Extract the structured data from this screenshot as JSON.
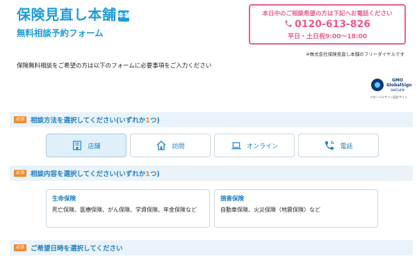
{
  "header": {
    "logo_main": "保険見直し本舗",
    "logo_mark": "本舗",
    "logo_sub": "無料相談予約フォーム"
  },
  "callbox": {
    "line1": "本日中のご相談希望の方は下記へお電話ください",
    "phone": "0120-613-826",
    "hours": "平日・土日祝9:00〜18:00",
    "color": "#e85a8f"
  },
  "note": "※株式会社保険見直し本舗のフリーダイヤルです",
  "intro": "保険無料相談をご希望の方は以下のフォームに必要事項をご入力ください",
  "gmo": {
    "line1": "GMO",
    "line2": "GlobalSign",
    "line3": "secure",
    "line4": "クローバルサイン認証サイト"
  },
  "required_label": "必須",
  "sections": [
    {
      "title_a": "相談方法を選択してください(いずれか",
      "count": "1",
      "title_b": "つ)"
    },
    {
      "title_a": "相談内容を選択してください(いずれか",
      "count": "1",
      "title_b": "つ)"
    },
    {
      "title": "ご希望日時を選択してください"
    }
  ],
  "methods": [
    {
      "label": "店舗",
      "icon": "store-icon",
      "selected": true
    },
    {
      "label": "訪問",
      "icon": "house-icon",
      "selected": false
    },
    {
      "label": "オンライン",
      "icon": "laptop-icon",
      "selected": false
    },
    {
      "label": "電話",
      "icon": "phone-icon",
      "selected": false
    }
  ],
  "topics": [
    {
      "title": "生命保険",
      "desc": "死亡保険、医療保険、がん保険、学資保険、年金保険など"
    },
    {
      "title": "損害保険",
      "desc": "自動車保険、火災保険（地震保険）など"
    }
  ],
  "colors": {
    "brand": "#1f9bd7",
    "heading": "#1f7fc2",
    "required": "#f08a2e",
    "section_bg": "#eaf3f9",
    "selected_bg": "#dff0fa"
  }
}
